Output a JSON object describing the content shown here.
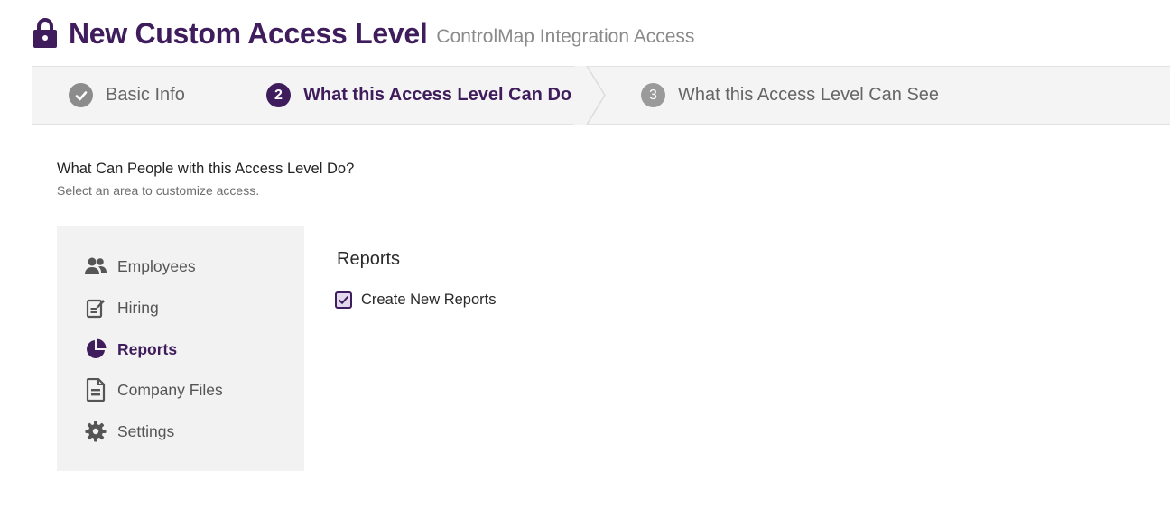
{
  "header": {
    "title": "New Custom Access Level",
    "subtitle": "ControlMap Integration Access",
    "icon": "lock-icon"
  },
  "stepper": {
    "steps": [
      {
        "number": "",
        "label": "Basic Info",
        "state": "completed",
        "icon": "check-circle-icon"
      },
      {
        "number": "2",
        "label": "What this Access Level Can Do",
        "state": "active"
      },
      {
        "number": "3",
        "label": "What this Access Level Can See",
        "state": "upcoming"
      }
    ]
  },
  "section": {
    "heading": "What Can People with this Access Level Do?",
    "subheading": "Select an area to customize access."
  },
  "sidebar": {
    "items": [
      {
        "label": "Employees",
        "icon": "people-icon",
        "active": false
      },
      {
        "label": "Hiring",
        "icon": "hiring-icon",
        "active": false
      },
      {
        "label": "Reports",
        "icon": "pie-chart-icon",
        "active": true
      },
      {
        "label": "Company Files",
        "icon": "file-icon",
        "active": false
      },
      {
        "label": "Settings",
        "icon": "gear-icon",
        "active": false
      }
    ]
  },
  "panel": {
    "title": "Reports",
    "permissions": [
      {
        "label": "Create New Reports",
        "checked": true
      }
    ]
  },
  "colors": {
    "accent": "#3f1d5c",
    "stepper_bg": "#f4f4f4",
    "sidebar_bg": "#f2f2f2",
    "muted_text": "#8a8a8a"
  }
}
